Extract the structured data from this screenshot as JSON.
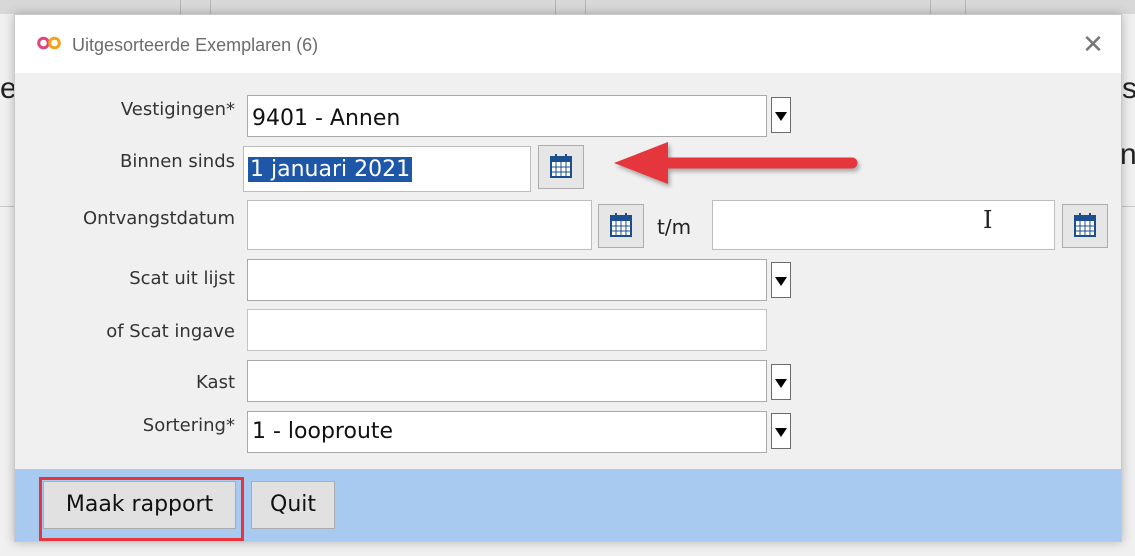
{
  "dialog": {
    "title": "Uitgesorteerde Exemplaren (6)",
    "close_icon": "close-icon",
    "app_icon": "infinity-logo-icon"
  },
  "form": {
    "vestigingen": {
      "label": "Vestigingen*",
      "value": "9401 - Annen"
    },
    "binnen_sinds": {
      "label": "Binnen sinds",
      "value": "1 januari 2021"
    },
    "ontvangstdatum": {
      "label": "Ontvangstdatum",
      "from_value": "",
      "to_label": "t/m",
      "to_value": ""
    },
    "scat_lijst": {
      "label": "Scat uit lijst",
      "value": ""
    },
    "scat_ingave": {
      "label": "of Scat ingave",
      "value": ""
    },
    "kast": {
      "label": "Kast",
      "value": ""
    },
    "sortering": {
      "label": "Sortering*",
      "value": "1 - looproute"
    }
  },
  "buttons": {
    "maak_rapport": "Maak rapport",
    "quit": "Quit"
  },
  "background": {
    "left_char": "e",
    "right_char_top": "s",
    "right_char_bottom": "n"
  },
  "colors": {
    "annotation_red": "#e5363d",
    "selection_blue": "#1e56a8",
    "bottom_bar": "#a8caf0"
  }
}
